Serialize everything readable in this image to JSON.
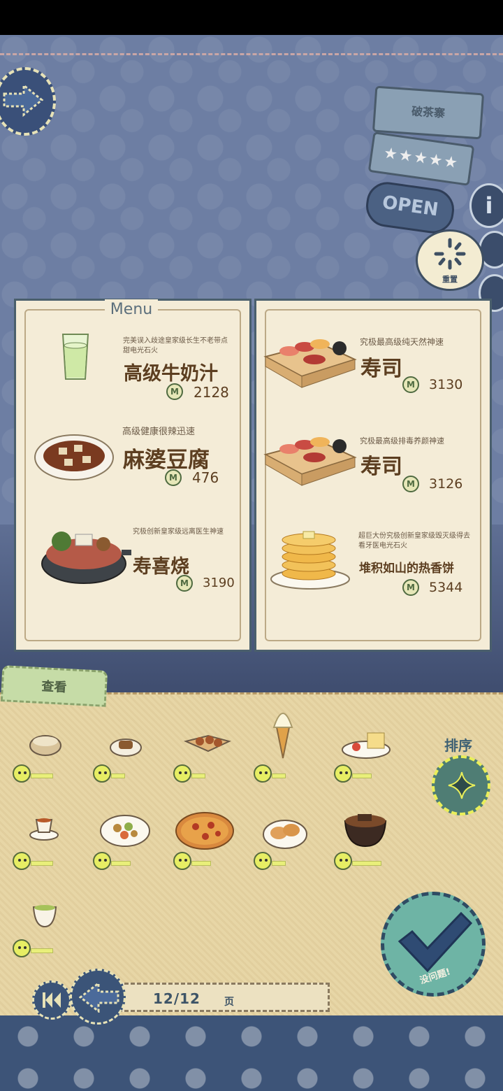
{
  "shop": {
    "name": "破茶寨",
    "stars": "★★★★★",
    "status": "OPEN",
    "reset_label": "重置"
  },
  "menu": {
    "title": "Menu",
    "currency_icon": "coin-m-icon",
    "coin_symbol": "M",
    "left_items": [
      {
        "desc": "完美误入歧途皇家级长生不老带点甜电光石火",
        "name": "高级牛奶汁",
        "price": "2128"
      },
      {
        "desc": "高级健康很辣迅速",
        "name": "麻婆豆腐",
        "price": "476"
      },
      {
        "desc": "究极创新皇家级远离医生神速",
        "name": "寿喜烧",
        "price": "3190"
      }
    ],
    "right_items": [
      {
        "desc": "究极最高级纯天然神速",
        "name": "寿司",
        "price": "3130"
      },
      {
        "desc": "究极最高级排毒养颜神速",
        "name": "寿司",
        "price": "3126"
      },
      {
        "desc": "超巨大份究极创新皇家级毁灭级得去看牙医电光石火",
        "name": "堆积如山的热香饼",
        "price": "5344"
      }
    ]
  },
  "catalog": {
    "view_tab": "查看",
    "sort_label": "排序",
    "ok_label": "没问题!",
    "foods": [
      {
        "icon": "soup-icon"
      },
      {
        "icon": "pastry-plate-icon"
      },
      {
        "icon": "takoyaki-icon"
      },
      {
        "icon": "soft-serve-icon"
      },
      {
        "icon": "cake-plate-icon"
      },
      {
        "icon": "tea-cup-icon"
      },
      {
        "icon": "salad-plate-icon"
      },
      {
        "icon": "pizza-icon"
      },
      {
        "icon": "croissant-plate-icon"
      },
      {
        "icon": "stew-bowl-icon"
      },
      {
        "icon": "green-tea-icon"
      }
    ]
  },
  "pager": {
    "current": "12",
    "total": "12",
    "text": "12/12",
    "unit": "页"
  },
  "colors": {
    "panel": "#f4ecd7",
    "ink": "#5c3e20",
    "accent_green": "#e7ee64",
    "footer": "#3d5478"
  }
}
